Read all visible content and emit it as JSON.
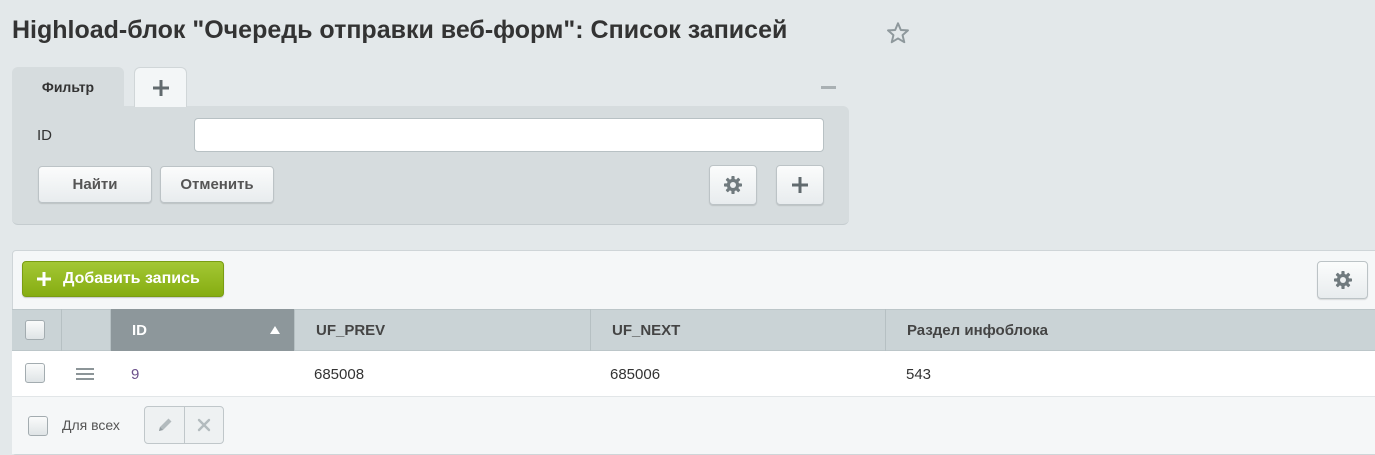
{
  "page": {
    "title": "Highload-блок \"Очередь отправки веб-форм\": Список записей"
  },
  "filter": {
    "tab_label": "Фильтр",
    "field_id_label": "ID",
    "field_id_value": "",
    "find_button": "Найти",
    "cancel_button": "Отменить"
  },
  "toolbar": {
    "add_record_label": "Добавить запись"
  },
  "table": {
    "columns": [
      "ID",
      "UF_PREV",
      "UF_NEXT",
      "Раздел инфоблока"
    ],
    "sorted_column": "ID",
    "sort_direction": "ascending",
    "rows": [
      {
        "id": "9",
        "uf_prev": "685008",
        "uf_next": "685006",
        "section": "543"
      }
    ],
    "footer": {
      "for_all_label": "Для всех"
    }
  },
  "icons": {
    "favorite": "star-icon",
    "add_tab": "plus-icon",
    "minimize": "minus-icon",
    "settings": "gear-icon",
    "row_menu": "hamburger-icon",
    "edit": "pencil-icon",
    "delete": "cross-icon"
  },
  "colors": {
    "background": "#e3e8ea",
    "accent_green": "#93b81e",
    "sorted_header": "#8d979b",
    "link_purple": "#6b4f8a"
  }
}
